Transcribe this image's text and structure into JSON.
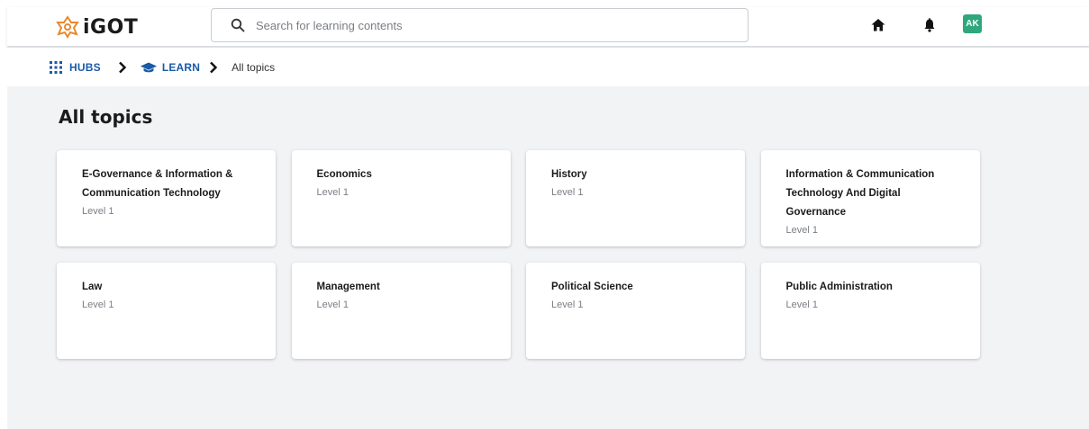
{
  "brand": {
    "name": "iGOT"
  },
  "search": {
    "placeholder": "Search for learning contents"
  },
  "header": {
    "avatar_initials": "AK",
    "avatar_color": "#2fa77d"
  },
  "breadcrumb": {
    "hubs": "HUBS",
    "learn": "LEARN",
    "current": "All topics",
    "link_color": "#1a5aa8"
  },
  "page": {
    "title": "All topics"
  },
  "topics": [
    {
      "title": "E-Governance & Information & Communication Technology",
      "level": "Level 1"
    },
    {
      "title": "Economics",
      "level": "Level 1"
    },
    {
      "title": "History",
      "level": "Level 1"
    },
    {
      "title": "Information & Communication Technology And Digital Governance",
      "level": "Level 1"
    },
    {
      "title": "Law",
      "level": "Level 1"
    },
    {
      "title": "Management",
      "level": "Level 1"
    },
    {
      "title": "Political Science",
      "level": "Level 1"
    },
    {
      "title": "Public Administration",
      "level": "Level 1"
    }
  ]
}
